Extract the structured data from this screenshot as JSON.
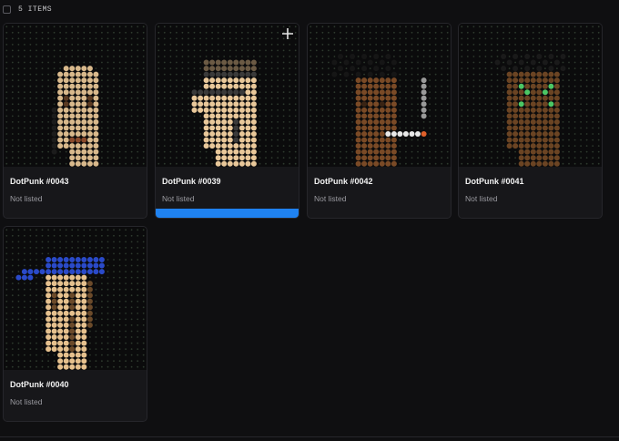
{
  "toolbar": {
    "items_count": "5 ITEMS"
  },
  "cards": [
    {
      "name": "DotPunk #0043",
      "status": "Not listed",
      "palette": {
        "skin": "#d9b98c",
        "dark": "#8a4a2c",
        "bg": "#141414"
      }
    },
    {
      "name": "DotPunk #0039",
      "status": "Not listed",
      "palette": {
        "skin": "#e9c89a",
        "dark": "#3a3a3a",
        "hat": "#6b5a44"
      }
    },
    {
      "name": "DotPunk #0042",
      "status": "Not listed",
      "palette": {
        "skin": "#7a4a26",
        "pipe": "#e8e8e8",
        "ember": "#e0602a"
      }
    },
    {
      "name": "DotPunk #0041",
      "status": "Not listed",
      "palette": {
        "skin": "#6b4423",
        "eyes": "#4cc765"
      }
    },
    {
      "name": "DotPunk #0040",
      "status": "Not listed",
      "palette": {
        "skin": "#e6c18e",
        "cap": "#2a4ac9",
        "dark": "#6b4a2a"
      }
    }
  ],
  "colors": {
    "accent": "#1f82f0",
    "background": "#0f0f11",
    "card": "#17171a"
  }
}
